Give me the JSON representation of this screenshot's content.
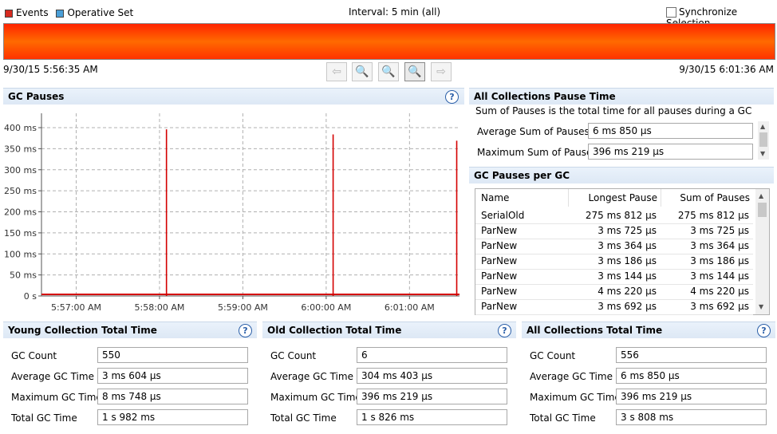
{
  "legend": {
    "events": "Events",
    "operative_set": "Operative Set",
    "events_color": "#d62a1f",
    "operative_color": "#4a9fd8"
  },
  "interval": "Interval: 5 min (all)",
  "sync_label": "Synchronize Selection",
  "timeline": {
    "start": "9/30/15 5:56:35 AM",
    "end": "9/30/15 6:01:36 AM"
  },
  "nav_icons": [
    "arrow-left-icon",
    "zoom-out-icon",
    "zoom-fit-icon",
    "zoom-in-icon",
    "arrow-right-icon"
  ],
  "gc_pauses": {
    "title": "GC Pauses",
    "chart_data": {
      "type": "line",
      "yticks": [
        "400 ms",
        "350 ms",
        "300 ms",
        "250 ms",
        "200 ms",
        "150 ms",
        "100 ms",
        "50 ms",
        "0 s"
      ],
      "xticks": [
        "5:57:00 AM",
        "5:58:00 AM",
        "5:59:00 AM",
        "6:00:00 AM",
        "6:01:00 AM"
      ],
      "ylim": [
        0,
        420
      ],
      "series_color": "#d40000",
      "spikes": [
        {
          "t": "5:58:05 AM",
          "value_ms": 396
        },
        {
          "t": "6:00:05 AM",
          "value_ms": 384
        },
        {
          "t": "6:01:34 AM",
          "value_ms": 369
        }
      ]
    }
  },
  "all_pause": {
    "title": "All Collections Pause Time",
    "desc": "Sum of Pauses is the total time for all pauses during a GC",
    "avg_label": "Average Sum of Pauses",
    "avg_value": "6 ms 850 µs",
    "max_label": "Maximum Sum of Pauses",
    "max_value": "396 ms 219 µs"
  },
  "per_gc": {
    "title": "GC Pauses per GC",
    "headers": [
      "Name",
      "Longest Pause",
      "Sum of Pauses"
    ],
    "rows": [
      [
        "SerialOld",
        "275 ms 812 µs",
        "275 ms 812 µs"
      ],
      [
        "ParNew",
        "3 ms 725 µs",
        "3 ms 725 µs"
      ],
      [
        "ParNew",
        "3 ms 364 µs",
        "3 ms 364 µs"
      ],
      [
        "ParNew",
        "3 ms 186 µs",
        "3 ms 186 µs"
      ],
      [
        "ParNew",
        "3 ms 144 µs",
        "3 ms 144 µs"
      ],
      [
        "ParNew",
        "4 ms 220 µs",
        "4 ms 220 µs"
      ],
      [
        "ParNew",
        "3 ms 692 µs",
        "3 ms 692 µs"
      ]
    ]
  },
  "panels": [
    {
      "title": "Young Collection Total Time",
      "rows": [
        [
          "GC Count",
          "550"
        ],
        [
          "Average GC Time",
          "3 ms 604 µs"
        ],
        [
          "Maximum GC Time",
          "8 ms 748 µs"
        ],
        [
          "Total GC Time",
          "1 s 982 ms"
        ]
      ]
    },
    {
      "title": "Old Collection Total Time",
      "rows": [
        [
          "GC Count",
          "6"
        ],
        [
          "Average GC Time",
          "304 ms 403 µs"
        ],
        [
          "Maximum GC Time",
          "396 ms 219 µs"
        ],
        [
          "Total GC Time",
          "1 s 826 ms"
        ]
      ]
    },
    {
      "title": "All Collections Total Time",
      "rows": [
        [
          "GC Count",
          "556"
        ],
        [
          "Average GC Time",
          "6 ms 850 µs"
        ],
        [
          "Maximum GC Time",
          "396 ms 219 µs"
        ],
        [
          "Total GC Time",
          "3 s 808 ms"
        ]
      ]
    }
  ],
  "help_glyph": "?"
}
